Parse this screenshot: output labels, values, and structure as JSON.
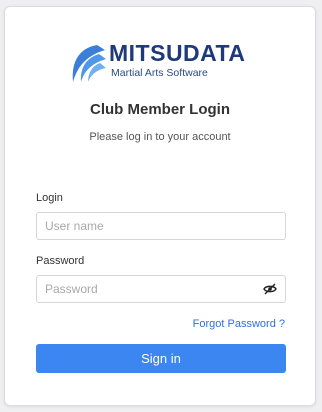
{
  "brand": {
    "name": "MITSUDATA",
    "tagline": "Martial Arts Software",
    "logo_icon": "swoosh-logo-icon"
  },
  "header": {
    "title": "Club Member Login",
    "subtitle": "Please log in to your account"
  },
  "form": {
    "login": {
      "label": "Login",
      "placeholder": "User name",
      "value": ""
    },
    "password": {
      "label": "Password",
      "placeholder": "Password",
      "value": "",
      "toggle_icon": "eye-slash-icon"
    },
    "forgot_link": "Forgot Password ?",
    "submit_label": "Sign in"
  },
  "colors": {
    "brand_navy": "#1e3a78",
    "brand_blue": "#3b7fd9",
    "primary": "#3b86f1",
    "link": "#2f6fdc"
  }
}
